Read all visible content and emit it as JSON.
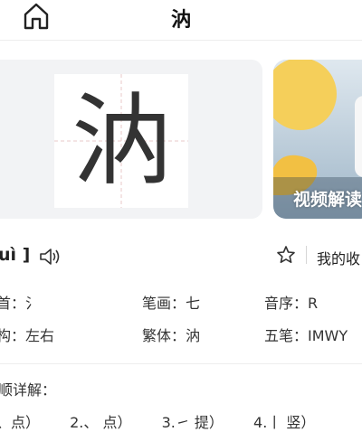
{
  "header": {
    "title": "汭",
    "home_icon": "home-icon"
  },
  "character": {
    "glyph": "汭"
  },
  "video": {
    "label": "视频解读"
  },
  "pinyin": {
    "text": "uì ]",
    "speaker_icon": "speaker-icon"
  },
  "favorite": {
    "label": "我的收",
    "star_icon": "star-icon"
  },
  "info": {
    "row1": [
      {
        "label": "首：",
        "value": "氵"
      },
      {
        "label": "笔画：",
        "value": "七"
      },
      {
        "label": "音序：",
        "value": "R"
      }
    ],
    "row2": [
      {
        "label": "构：",
        "value": "左右"
      },
      {
        "label": "繁体：",
        "value": "汭"
      },
      {
        "label": "五笔：",
        "value": "IMWY"
      }
    ]
  },
  "strokes_section": {
    "title": "顺详解："
  },
  "strokes": [
    "、点）",
    "2.、 点）",
    "3.㇀ 提）",
    "4.丨 竖）"
  ],
  "colors": {
    "card_bg": "#f2f3f5",
    "grid_line": "#e8c9c9",
    "video_yellow": "#f5cf5a"
  }
}
